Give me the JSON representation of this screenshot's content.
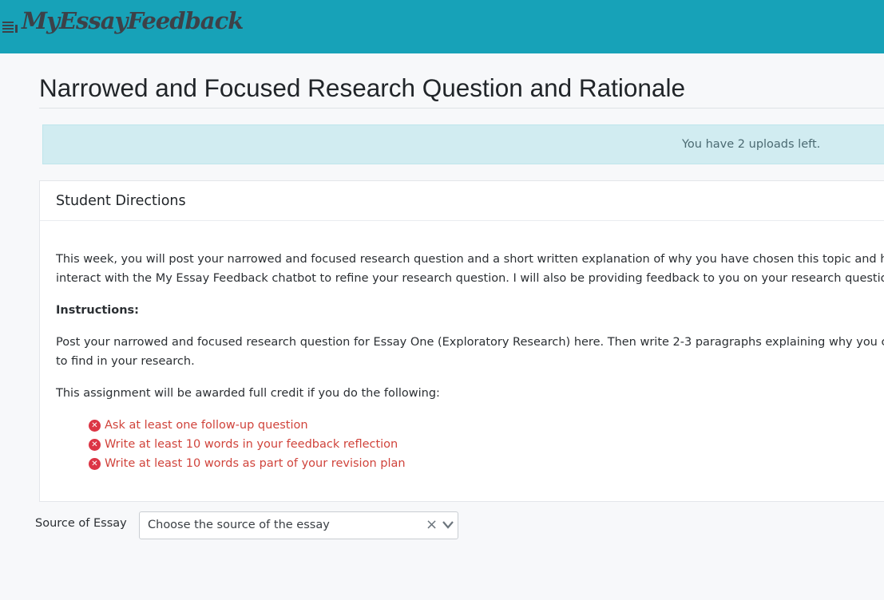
{
  "header": {
    "brand": "MyEssayFeedback",
    "menu_icon": "hamburger-icon",
    "bg_color": "#17a2b8"
  },
  "page": {
    "title": "Narrowed and Focused Research Question and Rationale"
  },
  "alert": {
    "text": "You have 2 uploads left.",
    "bg_color": "#d1ecf1"
  },
  "directions": {
    "heading": "Student Directions",
    "para1_line1": "This week, you will post your narrowed and focused research question and a short written explanation of why you have chosen this topic and how it",
    "para1_line2": "interact with the My Essay Feedback chatbot to refine your research question. I will also be providing feedback to you on your research question.",
    "instructions_label": "Instructions:",
    "para2_line1": "Post your narrowed and focused research question for Essay One (Exploratory Research) here. Then write 2-3 paragraphs explaining why you chose t",
    "para2_line2": "to find in your research.",
    "credit_text": "This assignment will be awarded full credit if you do the following:",
    "requirements": [
      {
        "text": "Ask at least one follow-up question",
        "status": "incomplete",
        "icon": "x-circle-icon"
      },
      {
        "text": "Write at least 10 words in your feedback reflection",
        "status": "incomplete",
        "icon": "x-circle-icon"
      },
      {
        "text": "Write at least 10 words as part of your revision plan",
        "status": "incomplete",
        "icon": "x-circle-icon"
      }
    ],
    "requirement_color": "#dc3545"
  },
  "source": {
    "label": "Source of Essay",
    "placeholder": "Choose the source of the essay",
    "clear_glyph": "×",
    "clear_icon": "clear-icon",
    "dropdown_icon": "chevron-down-icon"
  }
}
